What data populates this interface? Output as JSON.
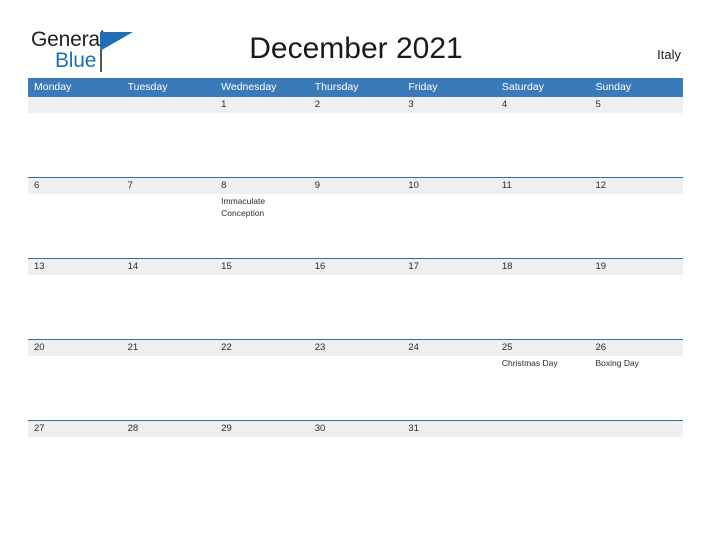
{
  "brand": {
    "name_part1": "General",
    "name_part2": "Blue",
    "triangle_icon": "triangle-icon"
  },
  "header": {
    "title": "December 2021",
    "country": "Italy"
  },
  "colors": {
    "header_blue": "#3b7ab8",
    "row_line_blue": "#2f6ea8",
    "date_band_gray": "#efefef",
    "brand_blue": "#1f6fb4",
    "text_dark": "#2b2b2b"
  },
  "calendar": {
    "weekdays": [
      "Monday",
      "Tuesday",
      "Wednesday",
      "Thursday",
      "Friday",
      "Saturday",
      "Sunday"
    ],
    "weeks": [
      {
        "days": [
          {
            "date": "",
            "event": ""
          },
          {
            "date": "",
            "event": ""
          },
          {
            "date": "1",
            "event": ""
          },
          {
            "date": "2",
            "event": ""
          },
          {
            "date": "3",
            "event": ""
          },
          {
            "date": "4",
            "event": ""
          },
          {
            "date": "5",
            "event": ""
          }
        ]
      },
      {
        "days": [
          {
            "date": "6",
            "event": ""
          },
          {
            "date": "7",
            "event": ""
          },
          {
            "date": "8",
            "event": "Immaculate Conception"
          },
          {
            "date": "9",
            "event": ""
          },
          {
            "date": "10",
            "event": ""
          },
          {
            "date": "11",
            "event": ""
          },
          {
            "date": "12",
            "event": ""
          }
        ]
      },
      {
        "days": [
          {
            "date": "13",
            "event": ""
          },
          {
            "date": "14",
            "event": ""
          },
          {
            "date": "15",
            "event": ""
          },
          {
            "date": "16",
            "event": ""
          },
          {
            "date": "17",
            "event": ""
          },
          {
            "date": "18",
            "event": ""
          },
          {
            "date": "19",
            "event": ""
          }
        ]
      },
      {
        "days": [
          {
            "date": "20",
            "event": ""
          },
          {
            "date": "21",
            "event": ""
          },
          {
            "date": "22",
            "event": ""
          },
          {
            "date": "23",
            "event": ""
          },
          {
            "date": "24",
            "event": ""
          },
          {
            "date": "25",
            "event": "Christmas Day"
          },
          {
            "date": "26",
            "event": "Boxing Day"
          }
        ]
      },
      {
        "days": [
          {
            "date": "27",
            "event": ""
          },
          {
            "date": "28",
            "event": ""
          },
          {
            "date": "29",
            "event": ""
          },
          {
            "date": "30",
            "event": ""
          },
          {
            "date": "31",
            "event": ""
          },
          {
            "date": "",
            "event": ""
          },
          {
            "date": "",
            "event": ""
          }
        ]
      }
    ]
  }
}
